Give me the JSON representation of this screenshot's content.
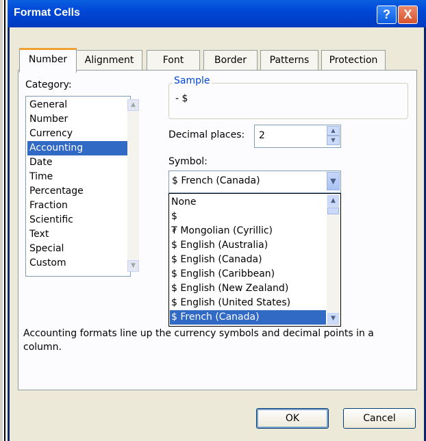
{
  "window": {
    "title": "Format Cells",
    "help_label": "?",
    "close_label": "X"
  },
  "tabs": [
    {
      "label": "Number"
    },
    {
      "label": "Alignment"
    },
    {
      "label": "Font"
    },
    {
      "label": "Border"
    },
    {
      "label": "Patterns"
    },
    {
      "label": "Protection"
    }
  ],
  "category": {
    "label": "Category:",
    "items": [
      "General",
      "Number",
      "Currency",
      "Accounting",
      "Date",
      "Time",
      "Percentage",
      "Fraction",
      "Scientific",
      "Text",
      "Special",
      "Custom"
    ],
    "selected": "Accounting"
  },
  "sample": {
    "legend": "Sample",
    "value": "-  $"
  },
  "decimal": {
    "label": "Decimal places:",
    "value": "2"
  },
  "symbol": {
    "label": "Symbol:",
    "value": "$ French (Canada)",
    "options": [
      "None",
      "$",
      "₮ Mongolian (Cyrillic)",
      "$ English (Australia)",
      "$ English (Canada)",
      "$ English (Caribbean)",
      "$ English (New Zealand)",
      "$ English (United States)",
      "$ French (Canada)"
    ],
    "selected": "$ French (Canada)"
  },
  "description": "Accounting formats line up the currency symbols and decimal points in a column.",
  "buttons": {
    "ok": "OK",
    "cancel": "Cancel"
  },
  "colors": {
    "title_bar": "#0047d6",
    "selection": "#316ac5",
    "dialog_bg": "#ece9d8"
  }
}
